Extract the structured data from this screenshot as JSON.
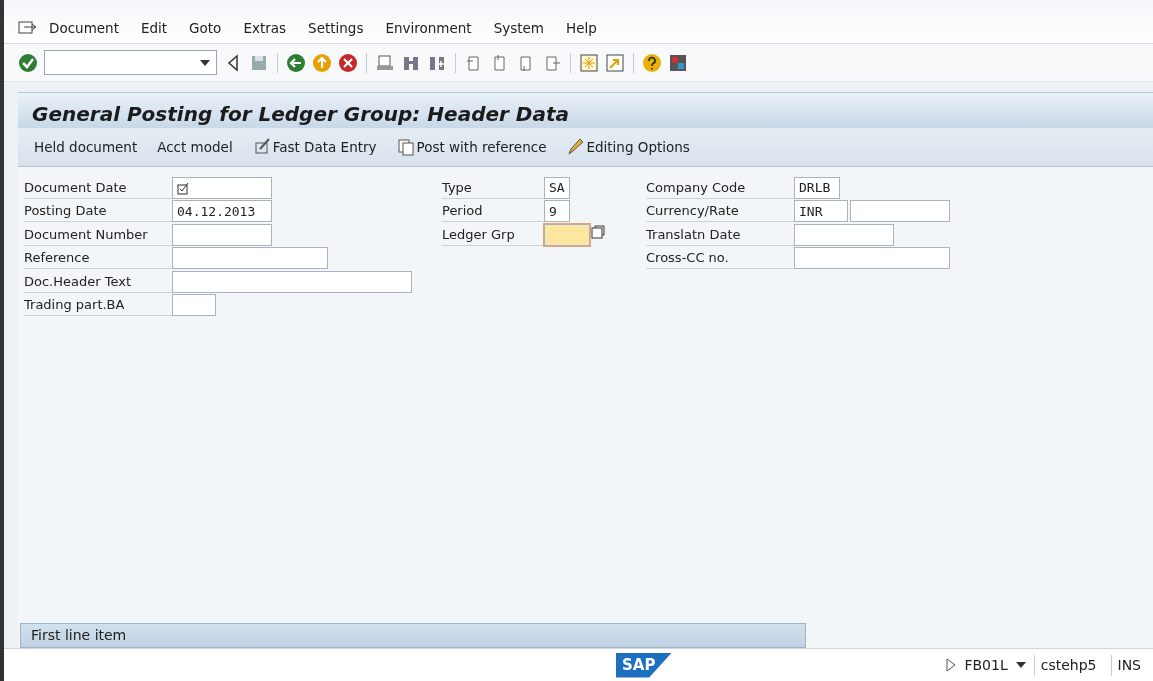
{
  "menu": [
    {
      "label": "Document"
    },
    {
      "label": "Edit"
    },
    {
      "label": "Goto"
    },
    {
      "label": "Extras"
    },
    {
      "label": "Settings"
    },
    {
      "label": "Environment"
    },
    {
      "label": "System"
    },
    {
      "label": "Help"
    }
  ],
  "title": "General Posting for Ledger Group: Header Data",
  "app_toolbar": [
    {
      "label": "Held document",
      "kind": "text"
    },
    {
      "label": "Acct model",
      "kind": "text"
    },
    {
      "label": "Fast Data Entry",
      "kind": "fast-entry"
    },
    {
      "label": "Post with reference",
      "kind": "copy"
    },
    {
      "label": "Editing Options",
      "kind": "pencil"
    }
  ],
  "columns": [
    [
      {
        "label": "Document Date",
        "required": true,
        "focused": false
      },
      {
        "label": "Posting Date",
        "value": "04.12.2013",
        "required": false,
        "focused": false
      },
      {
        "label": "Document Number",
        "required": false,
        "focused": false
      },
      {
        "label": "Reference",
        "required": false,
        "focused": false
      },
      {
        "label": "Doc.Header Text",
        "required": false,
        "focused": false
      },
      {
        "label": "Trading part.BA",
        "required": false,
        "focused": false
      }
    ],
    [
      {
        "label": "Type",
        "value": "SA",
        "required": false,
        "focused": false
      },
      {
        "label": "Period",
        "value": "9",
        "required": false,
        "focused": false
      },
      {
        "label": "Ledger Grp",
        "required": false,
        "focused": true
      }
    ],
    [
      {
        "label": "Company Code",
        "value": "DRLB",
        "required": false,
        "focused": false
      },
      {
        "label": "Currency/Rate",
        "value": "INR",
        "kind": "pair",
        "required": false,
        "focused": false
      },
      {
        "label": "Translatn Date",
        "required": false,
        "focused": false
      },
      {
        "label": "Cross-CC no.",
        "required": false,
        "focused": false
      }
    ]
  ],
  "section": {
    "title": "First line item"
  },
  "status_bar": {
    "logo": "SAP",
    "transaction": "FB01L",
    "server": "cstehp5",
    "mode": "INS"
  }
}
